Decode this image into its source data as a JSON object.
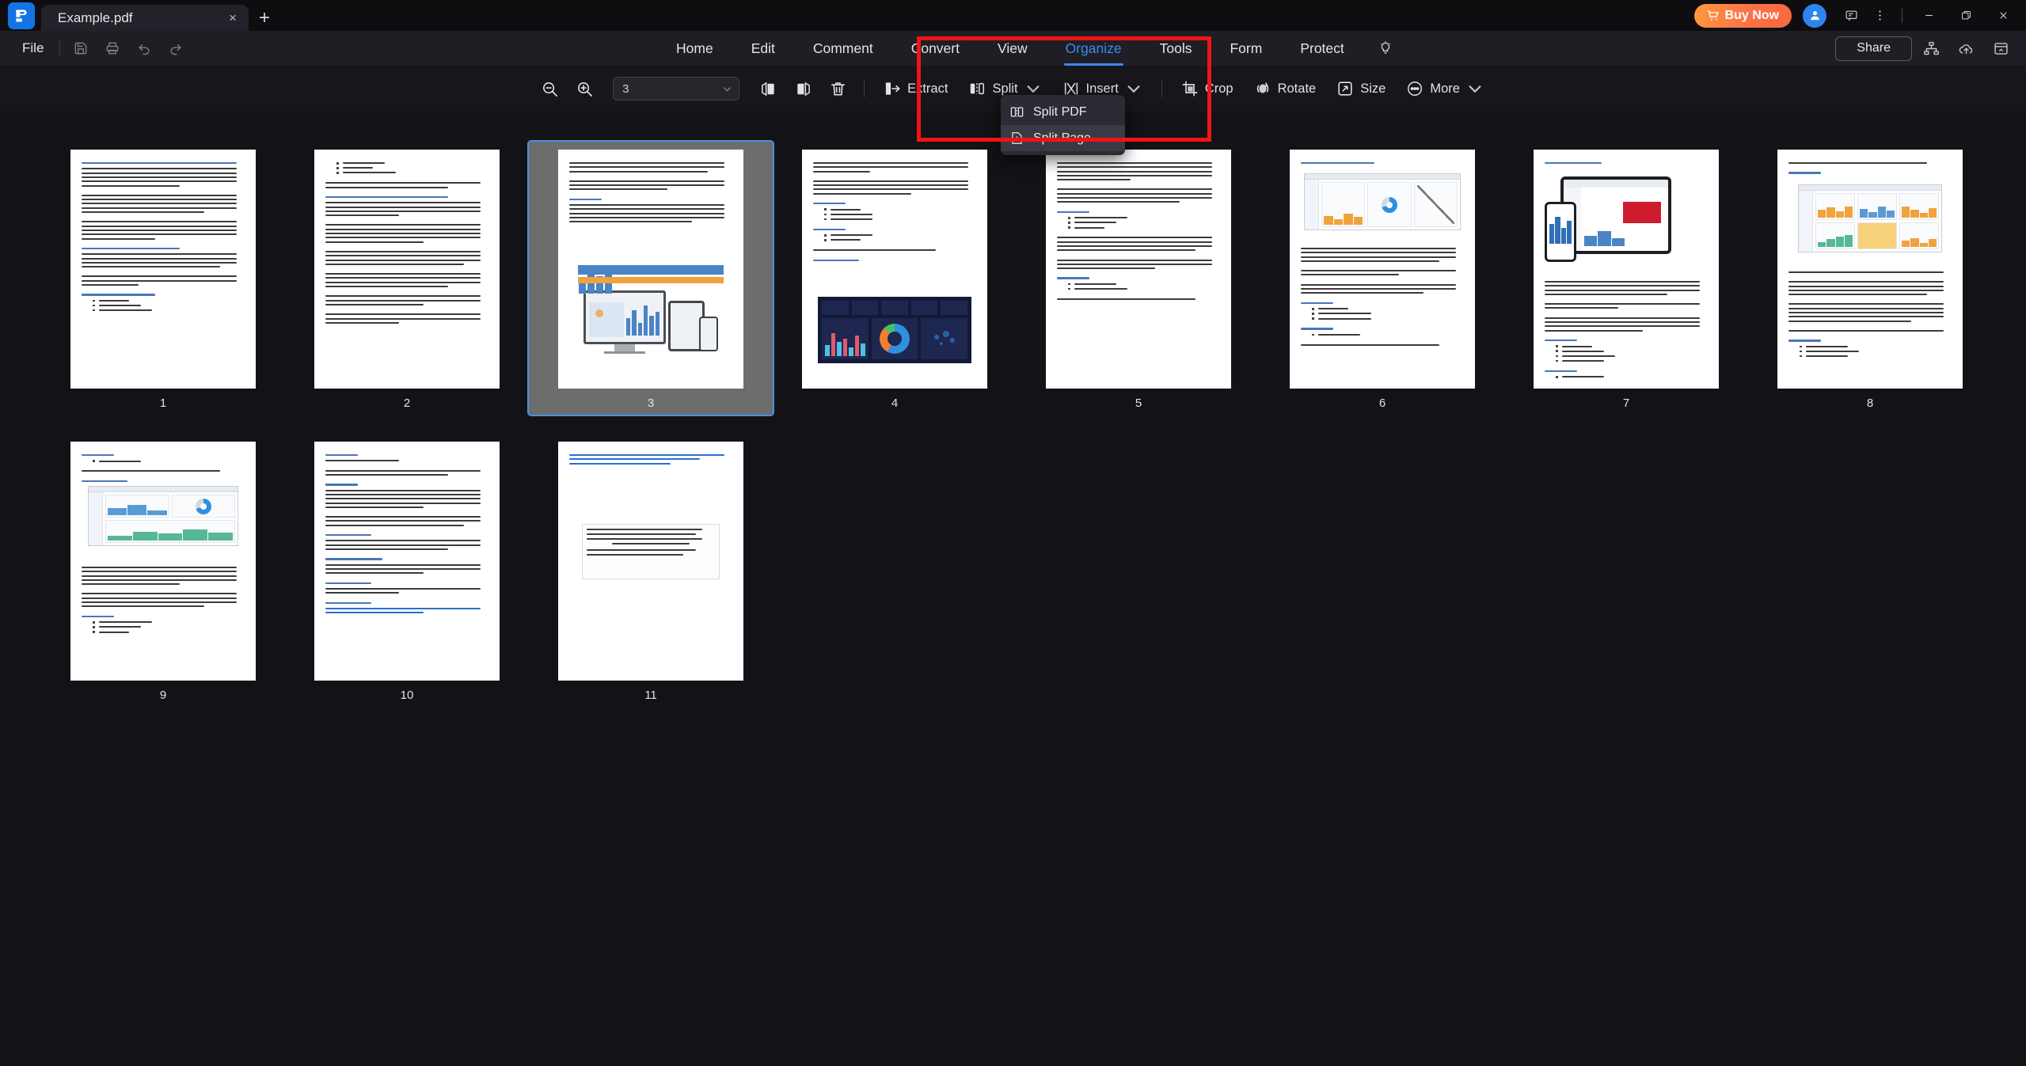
{
  "window": {
    "app_icon": "pdf-app-logo",
    "tab_title": "Example.pdf",
    "new_tab_label": "+",
    "close_tab_label": "×",
    "buy_now_label": "Buy Now",
    "minimize_label": "—",
    "maximize_label": "❐",
    "close_label": "✕"
  },
  "menu": {
    "file_label": "File",
    "tabs": [
      {
        "label": "Home",
        "active": false
      },
      {
        "label": "Edit",
        "active": false
      },
      {
        "label": "Comment",
        "active": false
      },
      {
        "label": "Convert",
        "active": false
      },
      {
        "label": "View",
        "active": false
      },
      {
        "label": "Organize",
        "active": true
      },
      {
        "label": "Tools",
        "active": false
      },
      {
        "label": "Form",
        "active": false
      },
      {
        "label": "Protect",
        "active": false
      }
    ],
    "share_label": "Share",
    "quick_icons": [
      "save-icon",
      "print-icon",
      "undo-icon",
      "redo-icon"
    ],
    "right_icons": [
      "bulb-icon",
      "org-chart-icon",
      "cloud-upload-icon",
      "panel-toggle-icon"
    ]
  },
  "toolbar": {
    "zoom_out_label": "zoom-out",
    "zoom_in_label": "zoom-in",
    "page_size_value": "3",
    "page_size_placeholder": "3",
    "buttons": [
      {
        "label": "Extract",
        "icon": "extract-icon",
        "has_caret": false
      },
      {
        "label": "Split",
        "icon": "split-icon",
        "has_caret": true
      },
      {
        "label": "Insert",
        "icon": "insert-icon",
        "has_caret": true
      },
      {
        "label": "Crop",
        "icon": "crop-icon",
        "has_caret": false
      },
      {
        "label": "Rotate",
        "icon": "rotate-icon",
        "has_caret": false
      },
      {
        "label": "Size",
        "icon": "size-icon",
        "has_caret": false
      },
      {
        "label": "More",
        "icon": "more-icon",
        "has_caret": true
      }
    ],
    "icon_buttons": [
      "page-left-icon",
      "page-right-icon",
      "delete-icon"
    ]
  },
  "split_dropdown": {
    "open": true,
    "items": [
      {
        "label": "Split PDF",
        "icon": "split-pdf-icon",
        "hovered": false
      },
      {
        "label": "Split Page",
        "icon": "split-page-icon",
        "hovered": true
      }
    ]
  },
  "annotation": {
    "color": "#f11414",
    "shape": "rectangle-highlight"
  },
  "thumbnails": {
    "selected_page": 3,
    "pages": [
      {
        "number": "1",
        "kind": "text"
      },
      {
        "number": "2",
        "kind": "text"
      },
      {
        "number": "3",
        "kind": "devices"
      },
      {
        "number": "4",
        "kind": "dashboard"
      },
      {
        "number": "5",
        "kind": "text"
      },
      {
        "number": "6",
        "kind": "shot-sap"
      },
      {
        "number": "7",
        "kind": "tablet-phone"
      },
      {
        "number": "8",
        "kind": "shot-tableau"
      },
      {
        "number": "9",
        "kind": "shot-zoho"
      },
      {
        "number": "10",
        "kind": "text"
      },
      {
        "number": "11",
        "kind": "links"
      }
    ]
  }
}
